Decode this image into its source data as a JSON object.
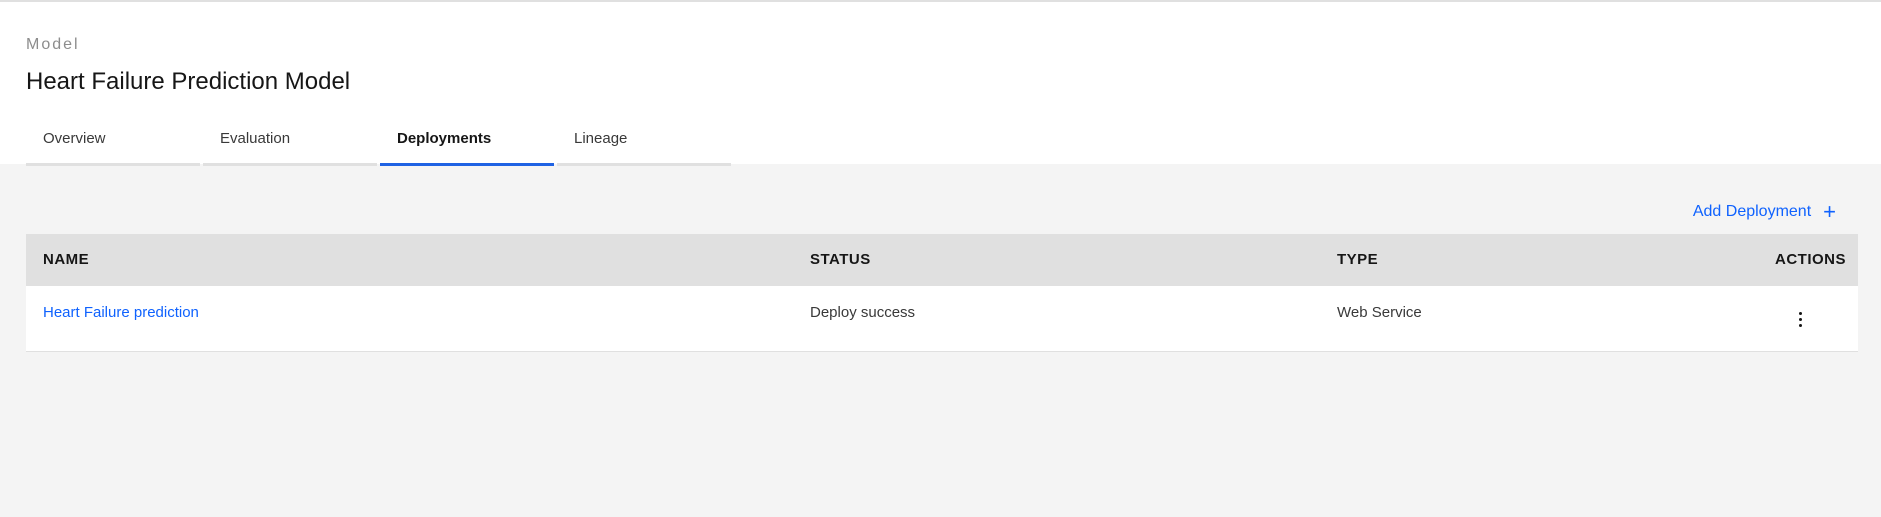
{
  "header": {
    "eyebrow": "Model",
    "title": "Heart Failure Prediction Model"
  },
  "tabs": [
    {
      "label": "Overview",
      "active": false
    },
    {
      "label": "Evaluation",
      "active": false
    },
    {
      "label": "Deployments",
      "active": true
    },
    {
      "label": "Lineage",
      "active": false
    }
  ],
  "toolbar": {
    "add_label": "Add Deployment",
    "add_icon": "plus-icon"
  },
  "table": {
    "columns": [
      "NAME",
      "STATUS",
      "TYPE",
      "ACTIONS"
    ],
    "rows": [
      {
        "name": "Heart Failure prediction",
        "status": "Deploy success",
        "type": "Web Service",
        "actions_icon": "overflow-menu-icon"
      }
    ]
  },
  "colors": {
    "accent": "#0f62fe",
    "active_tab": "#1f62e3",
    "background": "#f4f4f4",
    "header_bg": "#ffffff",
    "table_header_bg": "#e0e0e0"
  }
}
